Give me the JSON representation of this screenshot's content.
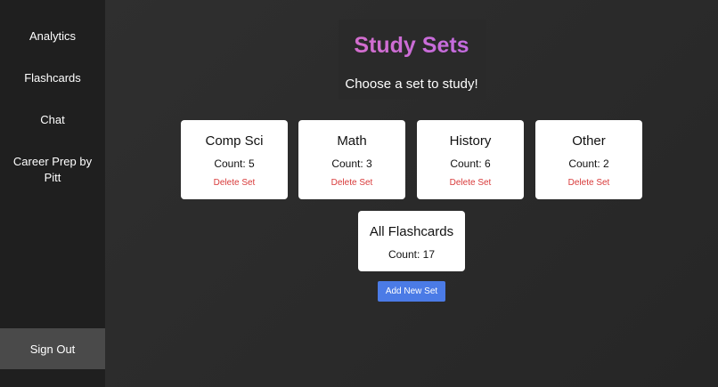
{
  "sidebar": {
    "items": [
      {
        "label": "Analytics"
      },
      {
        "label": "Flashcards"
      },
      {
        "label": "Chat"
      },
      {
        "label": "Career Prep by Pitt"
      }
    ],
    "sign_out_label": "Sign Out"
  },
  "header": {
    "title": "Study Sets",
    "subtitle": "Choose a set to study!"
  },
  "sets": [
    {
      "name": "Comp Sci",
      "count": "Count: 5",
      "delete_label": "Delete Set"
    },
    {
      "name": "Math",
      "count": "Count: 3",
      "delete_label": "Delete Set"
    },
    {
      "name": "History",
      "count": "Count: 6",
      "delete_label": "Delete Set"
    },
    {
      "name": "Other",
      "count": "Count: 2",
      "delete_label": "Delete Set"
    }
  ],
  "all_flashcards": {
    "name": "All Flashcards",
    "count": "Count: 17"
  },
  "add_button_label": "Add New Set",
  "colors": {
    "sidebar_bg": "#1f1f1f",
    "main_bg": "#2b2b2b",
    "sign_out_bg": "#4a4a4a",
    "title_gradient_start": "#f472a6",
    "title_gradient_end": "#a05ee0",
    "delete_red": "#d83a3a",
    "button_blue": "#4b7be6"
  }
}
